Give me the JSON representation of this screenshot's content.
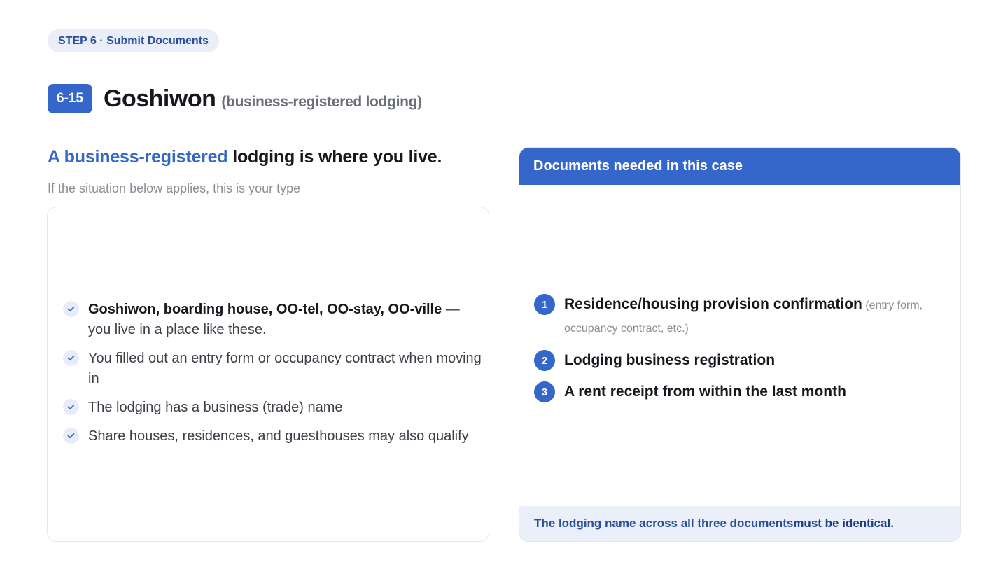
{
  "step_pill": "STEP 6 · Submit Documents",
  "title": {
    "code": "6-15",
    "main": "Goshiwon",
    "sub": "(business-registered lodging)"
  },
  "lead": {
    "accent": "A business-registered",
    "rest": " lodging is where you live.",
    "sub": "If the situation below applies, this is your type"
  },
  "checklist": [
    {
      "bold": "Goshiwon, boarding house, OO-tel, OO-stay, OO-ville",
      "text": " — you live in a place like these."
    },
    {
      "bold": "",
      "text": "You filled out an entry form or occupancy contract when moving in"
    },
    {
      "bold": "",
      "text": "The lodging has a business (trade) name"
    },
    {
      "bold": "",
      "text": "Share houses, residences, and guesthouses may also qualify"
    }
  ],
  "documents": {
    "header": "Documents needed in this case",
    "items": [
      {
        "num": "1",
        "label": "Residence/housing provision confirmation",
        "note": " (entry form, occupancy contract, etc.)"
      },
      {
        "num": "2",
        "label": "Lodging business registration",
        "note": ""
      },
      {
        "num": "3",
        "label": "A rent receipt from within the last month",
        "note": ""
      }
    ],
    "footer_pre": "The lodging name across all three documents ",
    "footer_strong": "must be identical",
    "footer_post": "."
  },
  "colors": {
    "accent": "#3566c9",
    "pill_bg": "#e9eef8",
    "footer_bg": "#eaeff9"
  }
}
